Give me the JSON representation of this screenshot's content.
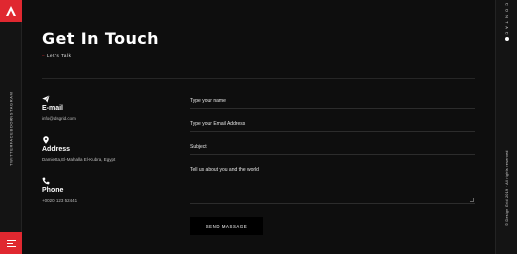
{
  "rail": {
    "social": [
      "INSTAGRAM",
      "FACEBOOK",
      "TWITTER"
    ]
  },
  "right": {
    "contact": "C O N T A C T",
    "copyright": "© Design Grid 2019 · All rights reserved"
  },
  "header": {
    "title": "Get In Touch",
    "subtitle": "Let's Talk"
  },
  "info": {
    "email_label": "E-mail",
    "email_value": "info@dsgrid.com",
    "address_label": "Address",
    "address_value": "Damietta,El-Mahalla El-Kubra, Egypt",
    "phone_label": "Phone",
    "phone_value": "+0020 123 52441"
  },
  "form": {
    "name_placeholder": "Type your name",
    "email_placeholder": "Type your Email Address",
    "subject_placeholder": "Subject",
    "message_placeholder": "Tell us about you and the world",
    "send_label": "SEND MASSAGE"
  },
  "colors": {
    "accent": "#e02830",
    "background": "#0e0e0e"
  },
  "icons": [
    "logo-a-icon",
    "menu-icon",
    "send-icon",
    "location-pin-icon",
    "phone-icon"
  ]
}
